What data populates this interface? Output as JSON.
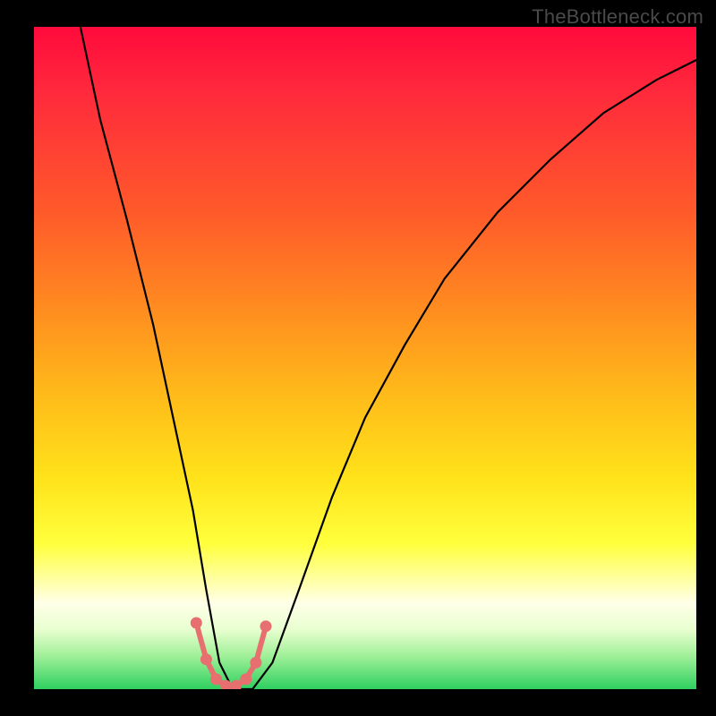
{
  "watermark": "TheBottleneck.com",
  "colors": {
    "frame": "#000000",
    "gradient_top": "#ff0a3c",
    "gradient_bottom": "#2ed060",
    "curve": "#000000",
    "marker": "#e76f6f"
  },
  "chart_data": {
    "type": "line",
    "title": "",
    "xlabel": "",
    "ylabel": "",
    "xlim": [
      0,
      100
    ],
    "ylim": [
      0,
      100
    ],
    "series": [
      {
        "name": "bottleneck-curve",
        "x": [
          7,
          10,
          14,
          18,
          21,
          24,
          26,
          28,
          30,
          33,
          36,
          40,
          45,
          50,
          56,
          62,
          70,
          78,
          86,
          94,
          100
        ],
        "values": [
          100,
          86,
          71,
          55,
          41,
          27,
          15,
          4,
          0,
          0,
          4,
          15,
          29,
          41,
          52,
          62,
          72,
          80,
          87,
          92,
          95
        ]
      }
    ],
    "markers": {
      "name": "highlight-region",
      "x": [
        24.5,
        26.0,
        27.5,
        29.0,
        30.5,
        32.0,
        33.5,
        35.0
      ],
      "values": [
        10.0,
        4.5,
        1.5,
        0.5,
        0.5,
        1.5,
        4.0,
        9.5
      ]
    }
  }
}
